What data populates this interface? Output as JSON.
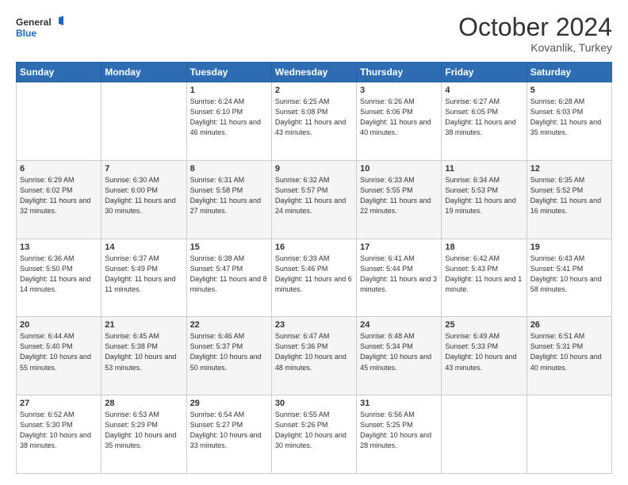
{
  "header": {
    "logo_line1": "General",
    "logo_line2": "Blue",
    "month_title": "October 2024",
    "subtitle": "Kovanlik, Turkey"
  },
  "weekdays": [
    "Sunday",
    "Monday",
    "Tuesday",
    "Wednesday",
    "Thursday",
    "Friday",
    "Saturday"
  ],
  "weeks": [
    [
      {
        "day": "",
        "sunrise": "",
        "sunset": "",
        "daylight": ""
      },
      {
        "day": "",
        "sunrise": "",
        "sunset": "",
        "daylight": ""
      },
      {
        "day": "1",
        "sunrise": "Sunrise: 6:24 AM",
        "sunset": "Sunset: 6:10 PM",
        "daylight": "Daylight: 11 hours and 46 minutes."
      },
      {
        "day": "2",
        "sunrise": "Sunrise: 6:25 AM",
        "sunset": "Sunset: 6:08 PM",
        "daylight": "Daylight: 11 hours and 43 minutes."
      },
      {
        "day": "3",
        "sunrise": "Sunrise: 6:26 AM",
        "sunset": "Sunset: 6:06 PM",
        "daylight": "Daylight: 11 hours and 40 minutes."
      },
      {
        "day": "4",
        "sunrise": "Sunrise: 6:27 AM",
        "sunset": "Sunset: 6:05 PM",
        "daylight": "Daylight: 11 hours and 38 minutes."
      },
      {
        "day": "5",
        "sunrise": "Sunrise: 6:28 AM",
        "sunset": "Sunset: 6:03 PM",
        "daylight": "Daylight: 11 hours and 35 minutes."
      }
    ],
    [
      {
        "day": "6",
        "sunrise": "Sunrise: 6:29 AM",
        "sunset": "Sunset: 6:02 PM",
        "daylight": "Daylight: 11 hours and 32 minutes."
      },
      {
        "day": "7",
        "sunrise": "Sunrise: 6:30 AM",
        "sunset": "Sunset: 6:00 PM",
        "daylight": "Daylight: 11 hours and 30 minutes."
      },
      {
        "day": "8",
        "sunrise": "Sunrise: 6:31 AM",
        "sunset": "Sunset: 5:58 PM",
        "daylight": "Daylight: 11 hours and 27 minutes."
      },
      {
        "day": "9",
        "sunrise": "Sunrise: 6:32 AM",
        "sunset": "Sunset: 5:57 PM",
        "daylight": "Daylight: 11 hours and 24 minutes."
      },
      {
        "day": "10",
        "sunrise": "Sunrise: 6:33 AM",
        "sunset": "Sunset: 5:55 PM",
        "daylight": "Daylight: 11 hours and 22 minutes."
      },
      {
        "day": "11",
        "sunrise": "Sunrise: 6:34 AM",
        "sunset": "Sunset: 5:53 PM",
        "daylight": "Daylight: 11 hours and 19 minutes."
      },
      {
        "day": "12",
        "sunrise": "Sunrise: 6:35 AM",
        "sunset": "Sunset: 5:52 PM",
        "daylight": "Daylight: 11 hours and 16 minutes."
      }
    ],
    [
      {
        "day": "13",
        "sunrise": "Sunrise: 6:36 AM",
        "sunset": "Sunset: 5:50 PM",
        "daylight": "Daylight: 11 hours and 14 minutes."
      },
      {
        "day": "14",
        "sunrise": "Sunrise: 6:37 AM",
        "sunset": "Sunset: 5:49 PM",
        "daylight": "Daylight: 11 hours and 11 minutes."
      },
      {
        "day": "15",
        "sunrise": "Sunrise: 6:38 AM",
        "sunset": "Sunset: 5:47 PM",
        "daylight": "Daylight: 11 hours and 8 minutes."
      },
      {
        "day": "16",
        "sunrise": "Sunrise: 6:39 AM",
        "sunset": "Sunset: 5:46 PM",
        "daylight": "Daylight: 11 hours and 6 minutes."
      },
      {
        "day": "17",
        "sunrise": "Sunrise: 6:41 AM",
        "sunset": "Sunset: 5:44 PM",
        "daylight": "Daylight: 11 hours and 3 minutes."
      },
      {
        "day": "18",
        "sunrise": "Sunrise: 6:42 AM",
        "sunset": "Sunset: 5:43 PM",
        "daylight": "Daylight: 11 hours and 1 minute."
      },
      {
        "day": "19",
        "sunrise": "Sunrise: 6:43 AM",
        "sunset": "Sunset: 5:41 PM",
        "daylight": "Daylight: 10 hours and 58 minutes."
      }
    ],
    [
      {
        "day": "20",
        "sunrise": "Sunrise: 6:44 AM",
        "sunset": "Sunset: 5:40 PM",
        "daylight": "Daylight: 10 hours and 55 minutes."
      },
      {
        "day": "21",
        "sunrise": "Sunrise: 6:45 AM",
        "sunset": "Sunset: 5:38 PM",
        "daylight": "Daylight: 10 hours and 53 minutes."
      },
      {
        "day": "22",
        "sunrise": "Sunrise: 6:46 AM",
        "sunset": "Sunset: 5:37 PM",
        "daylight": "Daylight: 10 hours and 50 minutes."
      },
      {
        "day": "23",
        "sunrise": "Sunrise: 6:47 AM",
        "sunset": "Sunset: 5:36 PM",
        "daylight": "Daylight: 10 hours and 48 minutes."
      },
      {
        "day": "24",
        "sunrise": "Sunrise: 6:48 AM",
        "sunset": "Sunset: 5:34 PM",
        "daylight": "Daylight: 10 hours and 45 minutes."
      },
      {
        "day": "25",
        "sunrise": "Sunrise: 6:49 AM",
        "sunset": "Sunset: 5:33 PM",
        "daylight": "Daylight: 10 hours and 43 minutes."
      },
      {
        "day": "26",
        "sunrise": "Sunrise: 6:51 AM",
        "sunset": "Sunset: 5:31 PM",
        "daylight": "Daylight: 10 hours and 40 minutes."
      }
    ],
    [
      {
        "day": "27",
        "sunrise": "Sunrise: 6:52 AM",
        "sunset": "Sunset: 5:30 PM",
        "daylight": "Daylight: 10 hours and 38 minutes."
      },
      {
        "day": "28",
        "sunrise": "Sunrise: 6:53 AM",
        "sunset": "Sunset: 5:29 PM",
        "daylight": "Daylight: 10 hours and 35 minutes."
      },
      {
        "day": "29",
        "sunrise": "Sunrise: 6:54 AM",
        "sunset": "Sunset: 5:27 PM",
        "daylight": "Daylight: 10 hours and 33 minutes."
      },
      {
        "day": "30",
        "sunrise": "Sunrise: 6:55 AM",
        "sunset": "Sunset: 5:26 PM",
        "daylight": "Daylight: 10 hours and 30 minutes."
      },
      {
        "day": "31",
        "sunrise": "Sunrise: 6:56 AM",
        "sunset": "Sunset: 5:25 PM",
        "daylight": "Daylight: 10 hours and 28 minutes."
      },
      {
        "day": "",
        "sunrise": "",
        "sunset": "",
        "daylight": ""
      },
      {
        "day": "",
        "sunrise": "",
        "sunset": "",
        "daylight": ""
      }
    ]
  ]
}
